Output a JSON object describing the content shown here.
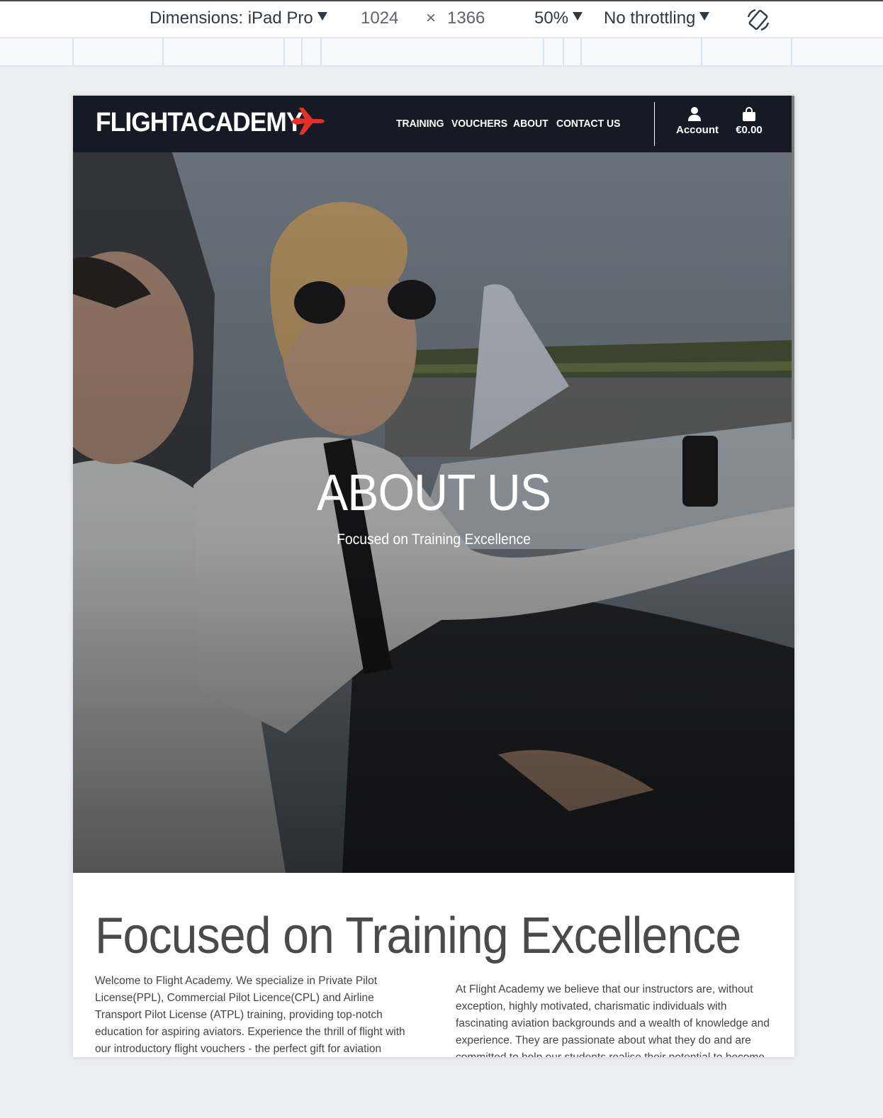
{
  "devtools": {
    "dimensions_label": "Dimensions: iPad Pro",
    "width": "1024",
    "times": "×",
    "height": "1366",
    "zoom": "50%",
    "throttling": "No throttling",
    "rotate_icon": "rotate-icon"
  },
  "header": {
    "logo_text": "FLIGHTACADEMY",
    "logo_icon": "airplane-icon",
    "nav": [
      "TRAINING",
      "VOUCHERS",
      "ABOUT",
      "CONTACT US"
    ],
    "account_label": "Account",
    "cart_total": "€0.00",
    "accent_color": "#e63027",
    "background_color": "#151a24"
  },
  "hero": {
    "title": "ABOUT US",
    "subtitle": "Focused on Training Excellence",
    "image_description": "pilots-in-cockpit"
  },
  "about": {
    "heading": "Focused on Training Excellence",
    "left_text": "Welcome to Flight Academy. We specialize in Private Pilot License(PPL), Commercial Pilot Licence(CPL) and Airline Transport Pilot License (ATPL) training, providing top-notch education for aspiring aviators. Experience the thrill of flight with our introductory flight vouchers - the perfect gift for aviation enthusiasts. Join us on a journey to the skies, where dreams take",
    "right_text": "At Flight Academy we believe that our instructors are, without exception, highly motivated, charismatic individuals with fascinating aviation backgrounds and a wealth of knowledge and experience. They are passionate about what they do and are committed to help our students realise their potential to become exceptional pilots."
  }
}
